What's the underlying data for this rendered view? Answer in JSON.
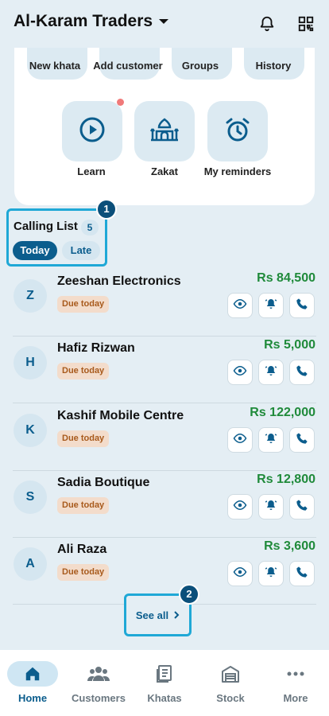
{
  "header": {
    "business_name": "Al-Karam Traders",
    "icons": [
      "bell-icon",
      "qr-code-icon"
    ]
  },
  "quick_actions_top": [
    {
      "label": "New khata"
    },
    {
      "label": "Add customer"
    },
    {
      "label": "Groups"
    },
    {
      "label": "History"
    }
  ],
  "quick_actions": [
    {
      "label": "Learn",
      "icon": "play-icon",
      "has_dot": true
    },
    {
      "label": "Zakat",
      "icon": "mosque-icon"
    },
    {
      "label": "My reminders",
      "icon": "alarm-clock-icon"
    }
  ],
  "calling_list": {
    "title": "Calling List",
    "count": "5",
    "tabs": [
      {
        "label": "Today",
        "active": true
      },
      {
        "label": "Late",
        "active": false
      }
    ]
  },
  "annotations": {
    "badge_1": "1",
    "badge_2": "2"
  },
  "customers": [
    {
      "initial": "Z",
      "name": "Zeeshan Electronics",
      "status": "Due today",
      "amount": "Rs 84,500"
    },
    {
      "initial": "H",
      "name": "Hafiz Rizwan",
      "status": "Due today",
      "amount": "Rs 5,000"
    },
    {
      "initial": "K",
      "name": "Kashif Mobile Centre",
      "status": "Due today",
      "amount": "Rs 122,000"
    },
    {
      "initial": "S",
      "name": "Sadia Boutique",
      "status": "Due today",
      "amount": "Rs 12,800"
    },
    {
      "initial": "A",
      "name": "Ali Raza",
      "status": "Due today",
      "amount": "Rs 3,600"
    }
  ],
  "see_all": {
    "label": "See all"
  },
  "bottom_nav": [
    {
      "label": "Home",
      "icon": "home-icon",
      "active": true
    },
    {
      "label": "Customers",
      "icon": "customers-icon"
    },
    {
      "label": "Khatas",
      "icon": "ledger-icon"
    },
    {
      "label": "Stock",
      "icon": "warehouse-icon"
    },
    {
      "label": "More",
      "icon": "more-icon"
    }
  ],
  "colors": {
    "primary": "#0b5d8d",
    "amount_green": "#1f8a3a",
    "due_bg": "#f3dccb",
    "due_text": "#a85a1c",
    "highlight": "#1fa8d6",
    "background": "#e4eef4"
  }
}
